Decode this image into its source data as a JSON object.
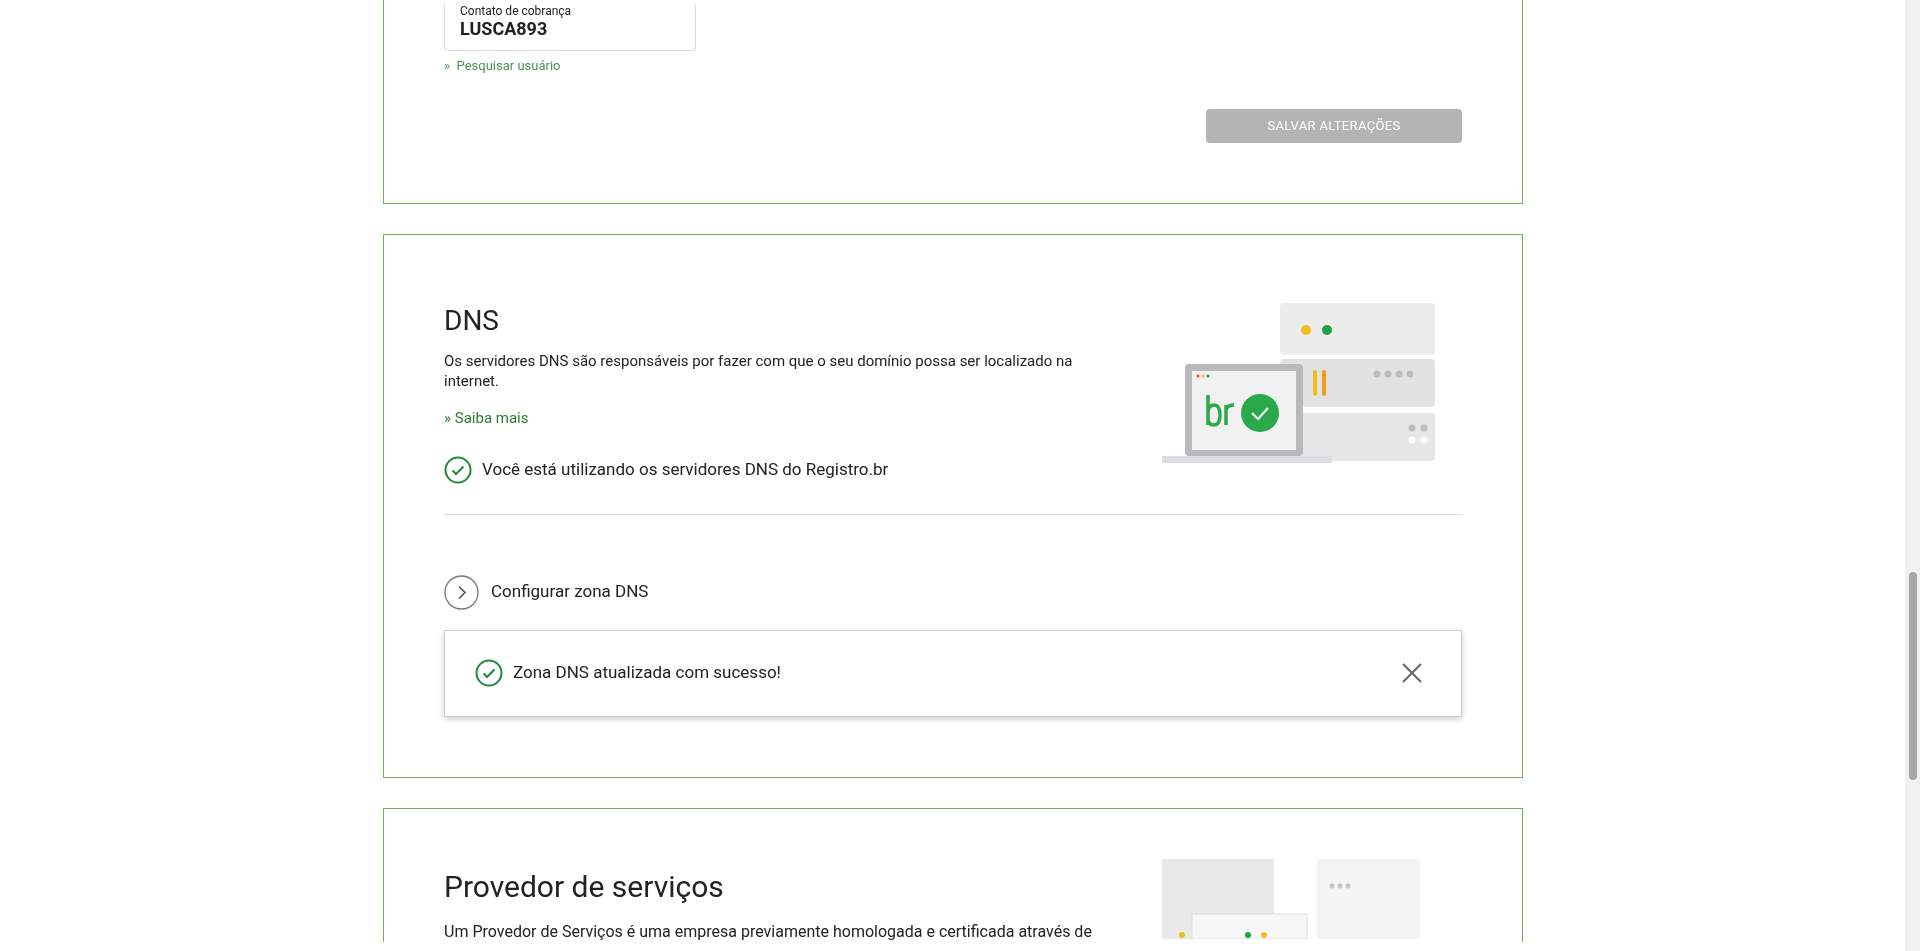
{
  "contact_card": {
    "label": "Contato de cobrança",
    "value": "LUSCA893",
    "search_link": "»  Pesquisar usuário",
    "save_button": {
      "label": "SALVAR ALTERAÇÕES",
      "disabled": true
    }
  },
  "dns": {
    "title": "DNS",
    "description": "Os servidores DNS são responsáveis por fazer com que o seu domínio possa ser localizado na internet.",
    "learn_more": "» Saiba mais",
    "status": "Você está utilizando os servidores DNS do Registro.br",
    "configure": {
      "label": "Configurar zona DNS",
      "expanded": false
    },
    "toast": {
      "kind": "success",
      "message": "Zona DNS atualizada com sucesso!"
    }
  },
  "provider": {
    "title": "Provedor de serviços",
    "description": "Um Provedor de Serviços é uma empresa previamente homologada e certificada através de"
  }
}
